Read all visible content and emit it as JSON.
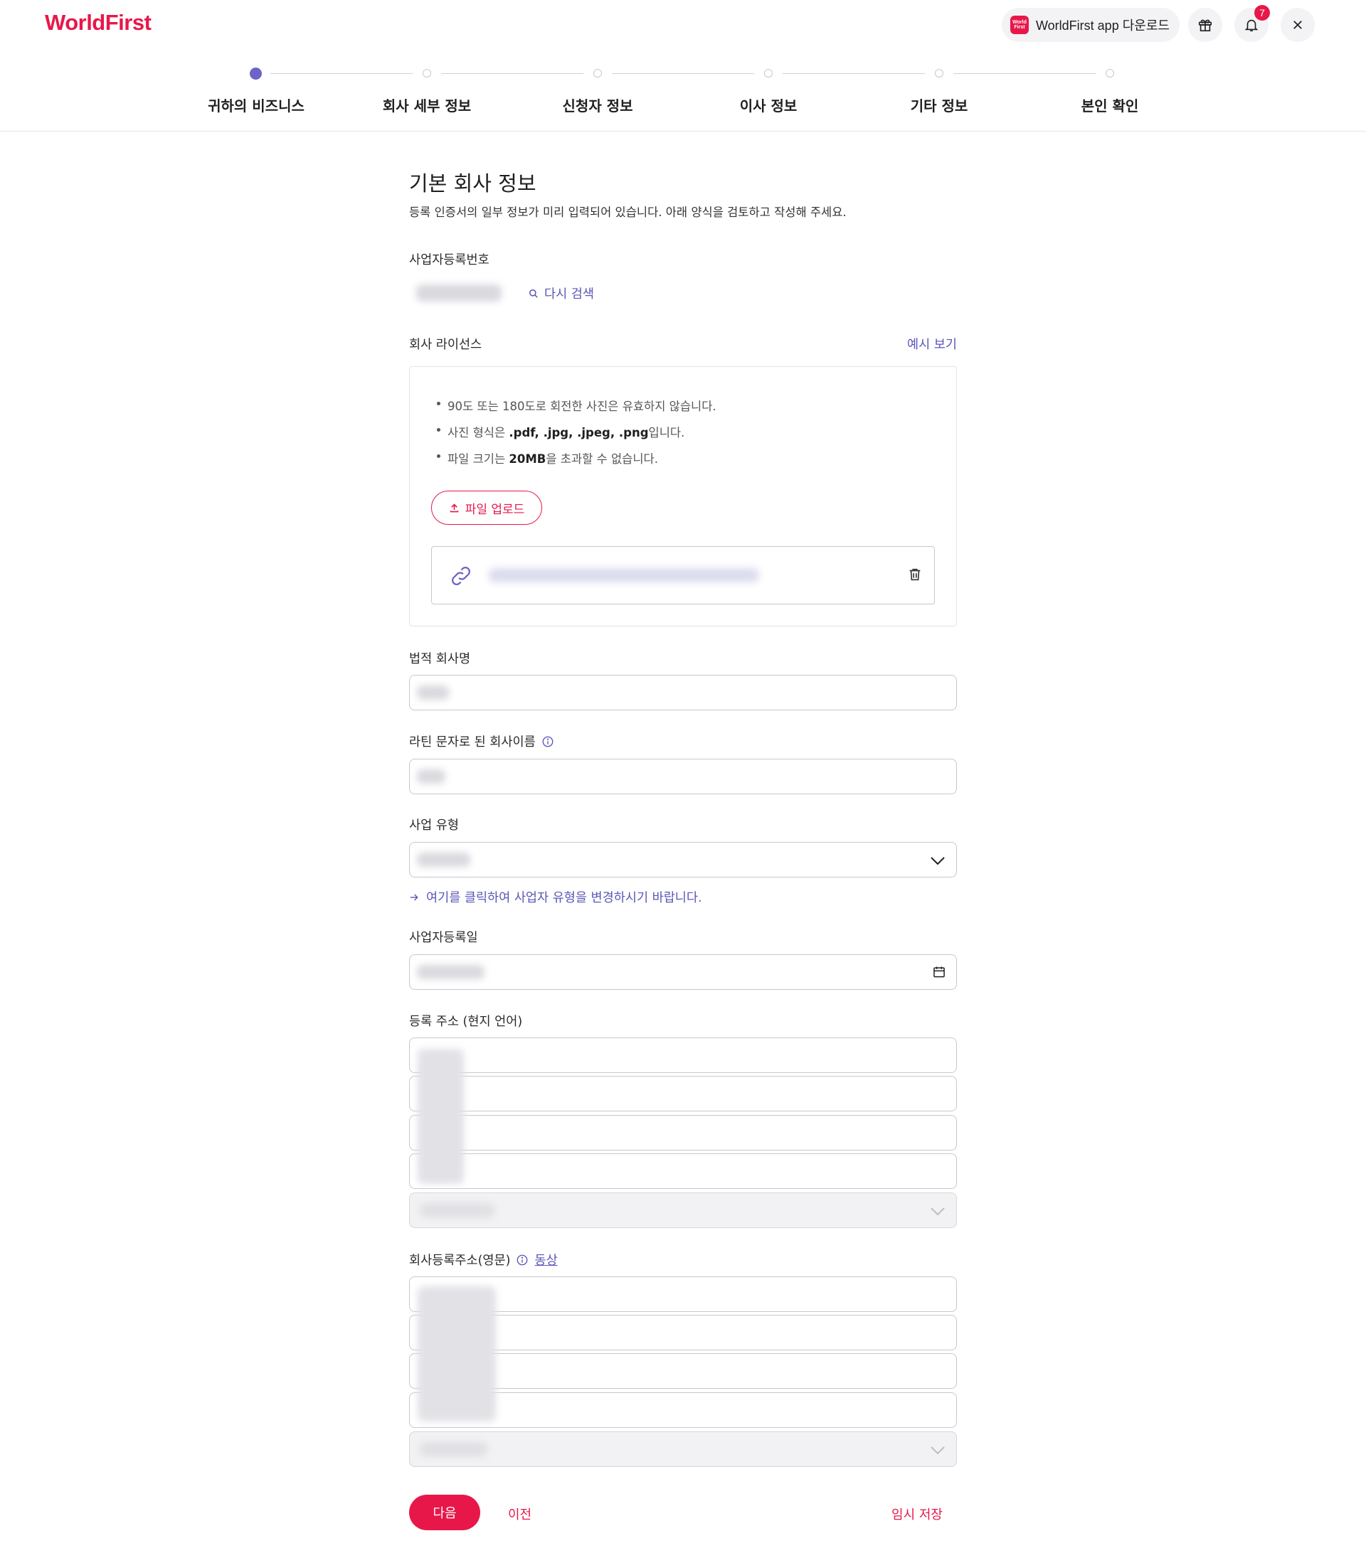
{
  "header": {
    "logo": "WorldFirst",
    "app_download_label": "WorldFirst app 다운로드",
    "app_icon_text": "World First",
    "notification_count": "7",
    "brand_color": "#e8174a",
    "accent_color": "#6b65c5"
  },
  "stepper": {
    "steps": [
      {
        "label": "귀하의 비즈니스",
        "active": true
      },
      {
        "label": "회사 세부 정보",
        "active": false
      },
      {
        "label": "신청자 정보",
        "active": false
      },
      {
        "label": "이사 정보",
        "active": false
      },
      {
        "label": "기타 정보",
        "active": false
      },
      {
        "label": "본인 확인",
        "active": false
      }
    ]
  },
  "form": {
    "title": "기본 회사 정보",
    "description": "등록 인증서의 일부 정보가 미리 입력되어 있습니다. 아래 양식을 검토하고 작성해 주세요.",
    "brn_label": "사업자등록번호",
    "re_search_label": "다시 검색",
    "license_label": "회사 라이선스",
    "example_link": "예시 보기",
    "upload_rules": {
      "rule1": "90도 또는 180도로 회전한 사진은 유효하지 않습니다.",
      "rule2_prefix": "사진 형식은 ",
      "rule2_bold": ".pdf, .jpg, .jpeg, .png",
      "rule2_suffix": "입니다.",
      "rule3_prefix": "파일 크기는 ",
      "rule3_bold": "20MB",
      "rule3_suffix": "을 초과할 수 없습니다."
    },
    "upload_button": "파일 업로드",
    "legal_name_label": "법적 회사명",
    "latin_name_label": "라틴 문자로 된 회사이름",
    "business_type_label": "사업 유형",
    "change_type_link": "여기를 클릭하여 사업자 유형을 변경하시기 바랍니다.",
    "reg_date_label": "사업자등록일",
    "address_local_label": "등록 주소 (현지 언어)",
    "address_en_label": "회사등록주소(영문)",
    "address_en_link": "동상"
  },
  "footer": {
    "next": "다음",
    "prev": "이전",
    "save": "임시 저장"
  }
}
